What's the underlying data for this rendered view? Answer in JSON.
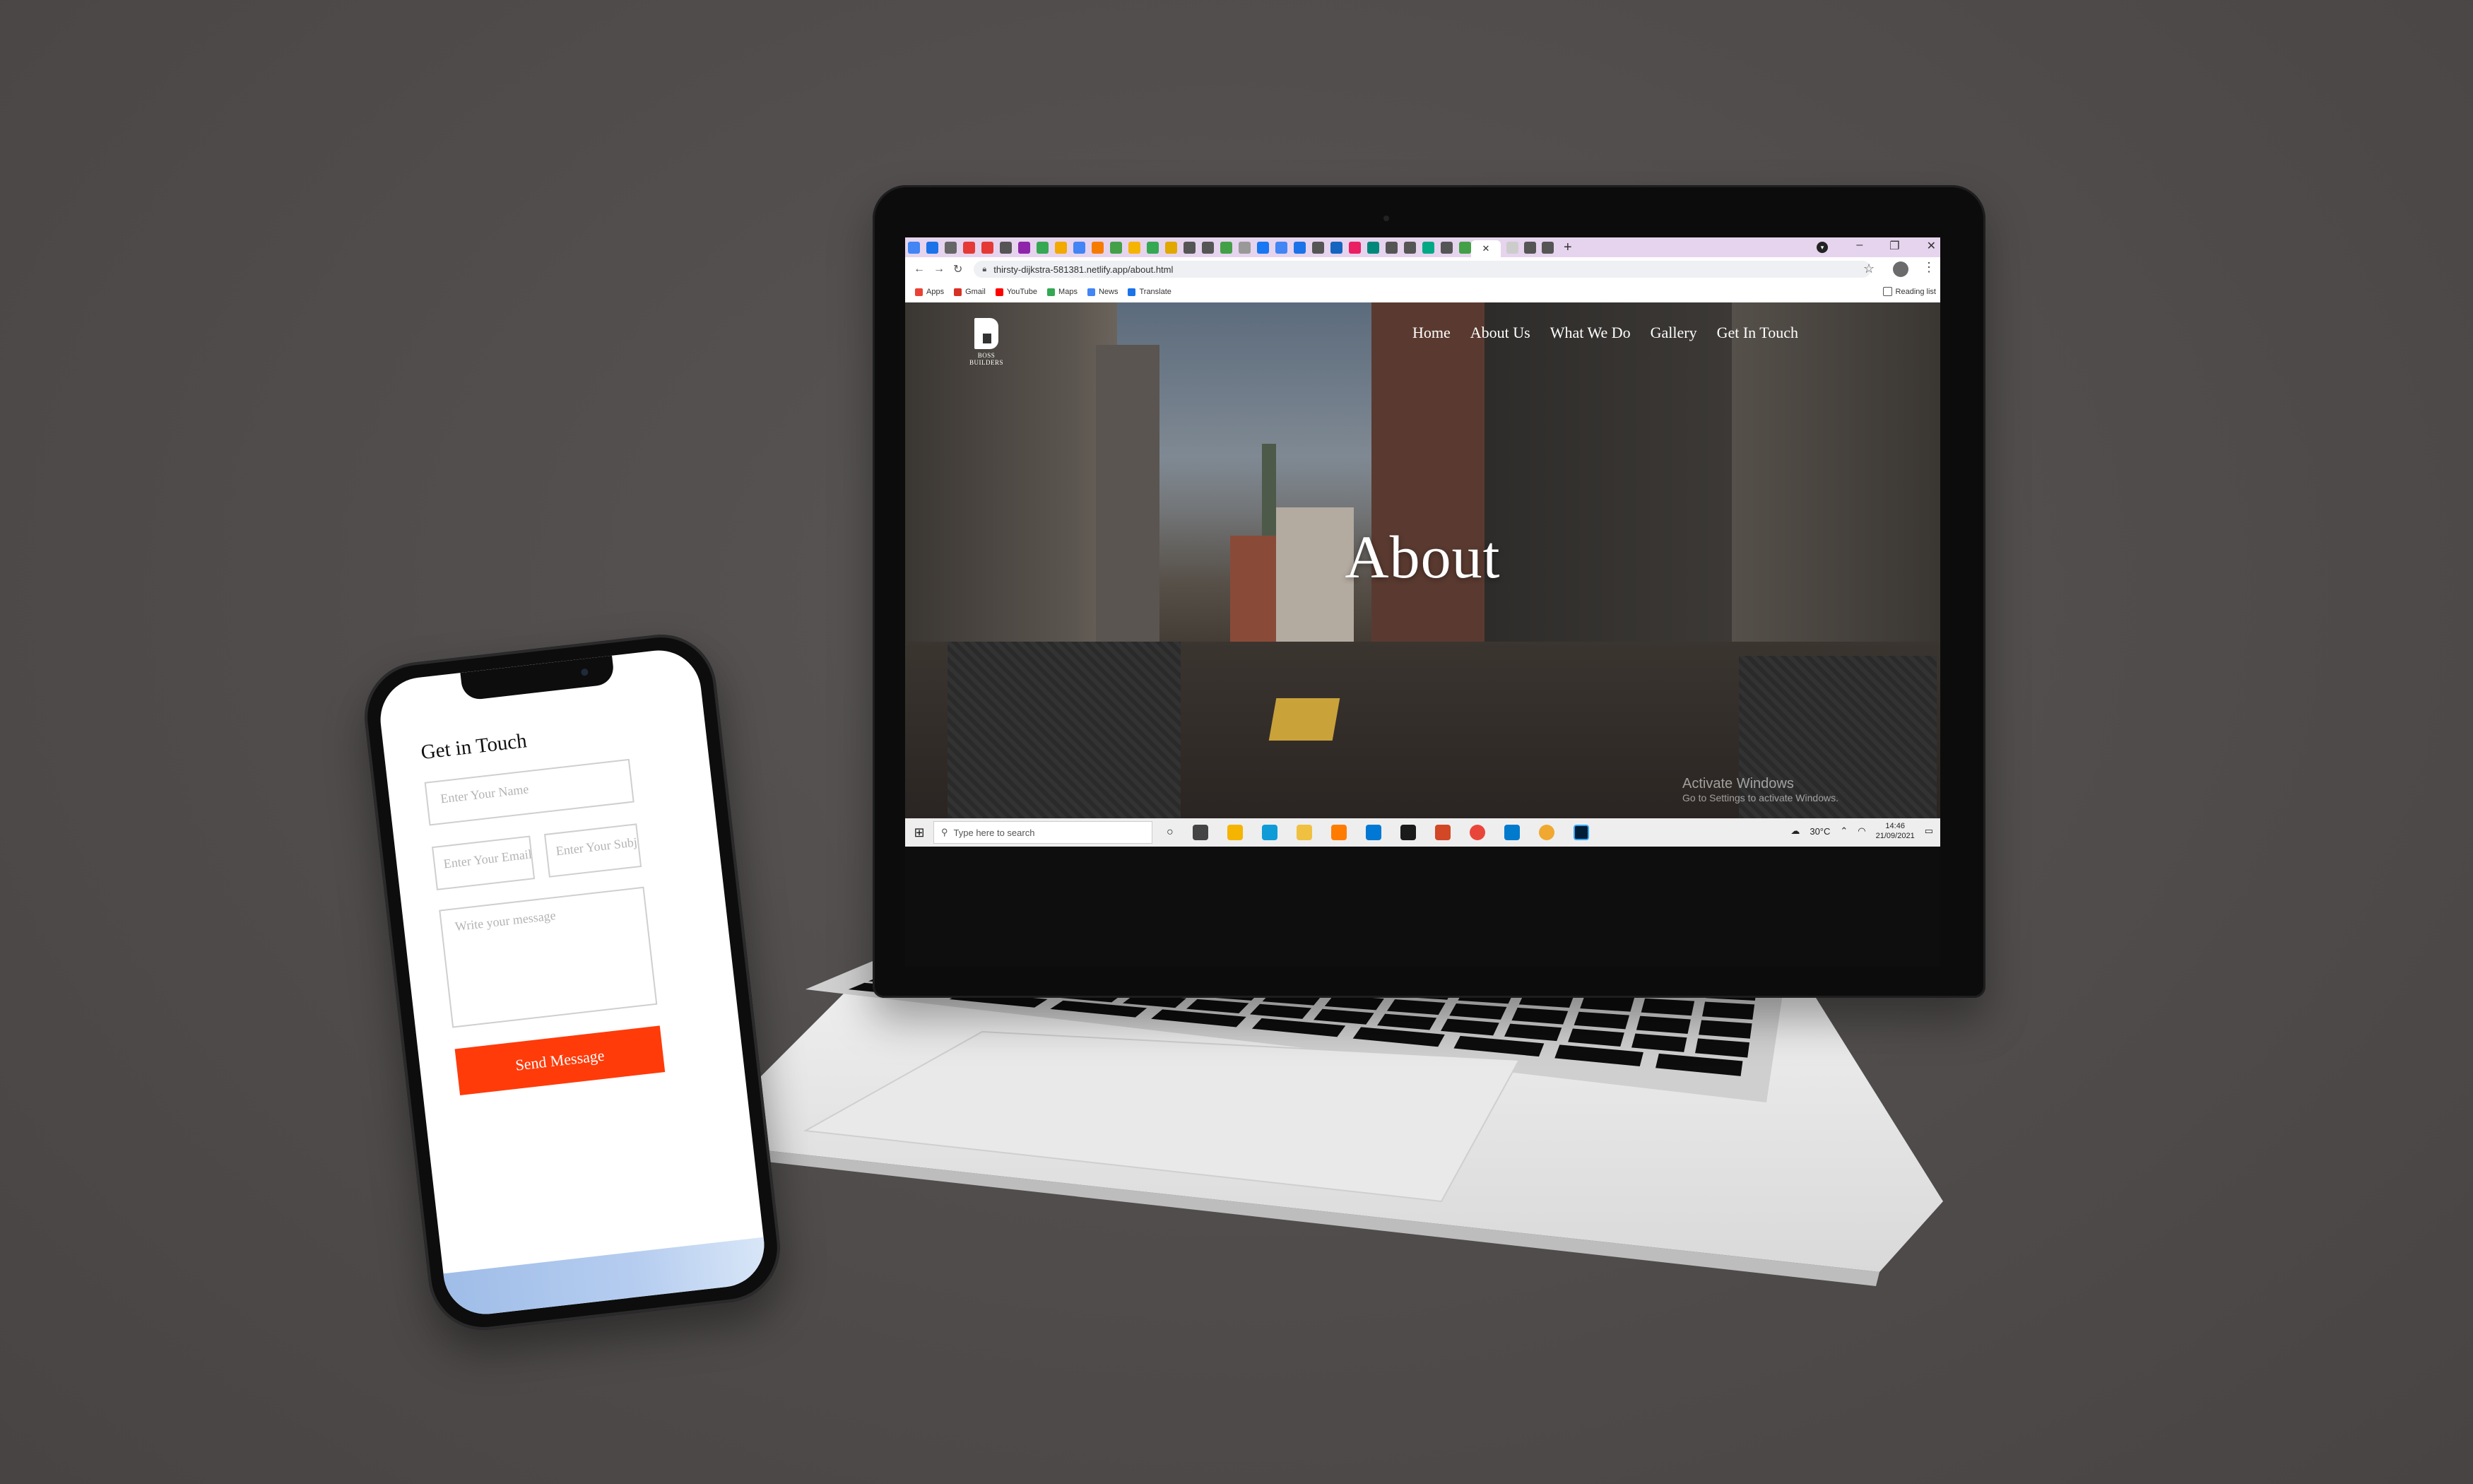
{
  "browser": {
    "url": "thirsty-dijkstra-581381.netlify.app/about.html",
    "bookmarks": [
      "Apps",
      "Gmail",
      "YouTube",
      "Maps",
      "News",
      "Translate"
    ],
    "reading_list": "Reading list",
    "win_minimize": "–",
    "win_restore": "❐",
    "win_close": "✕",
    "tab_close": "✕",
    "new_tab": "+"
  },
  "site": {
    "logo_text": "BOSS BUILDERS",
    "nav": [
      "Home",
      "About Us",
      "What We Do",
      "Gallery",
      "Get In Touch"
    ],
    "hero_title": "About"
  },
  "windows": {
    "watermark_title": "Activate Windows",
    "watermark_sub": "Go to Settings to activate Windows.",
    "search_placeholder": "Type here to search",
    "temperature": "30°C",
    "time": "14:46",
    "date": "21/09/2021"
  },
  "phone": {
    "form_title": "Get in Touch",
    "name_placeholder": "Enter Your Name",
    "email_placeholder": "Enter Your Email",
    "subject_placeholder": "Enter Your Subject",
    "message_placeholder": "Write your message",
    "send_label": "Send Message"
  },
  "colors": {
    "background": "#4f4b4b",
    "accent_button": "#ff3b0a",
    "tab_strip": "#e6d4ee"
  }
}
